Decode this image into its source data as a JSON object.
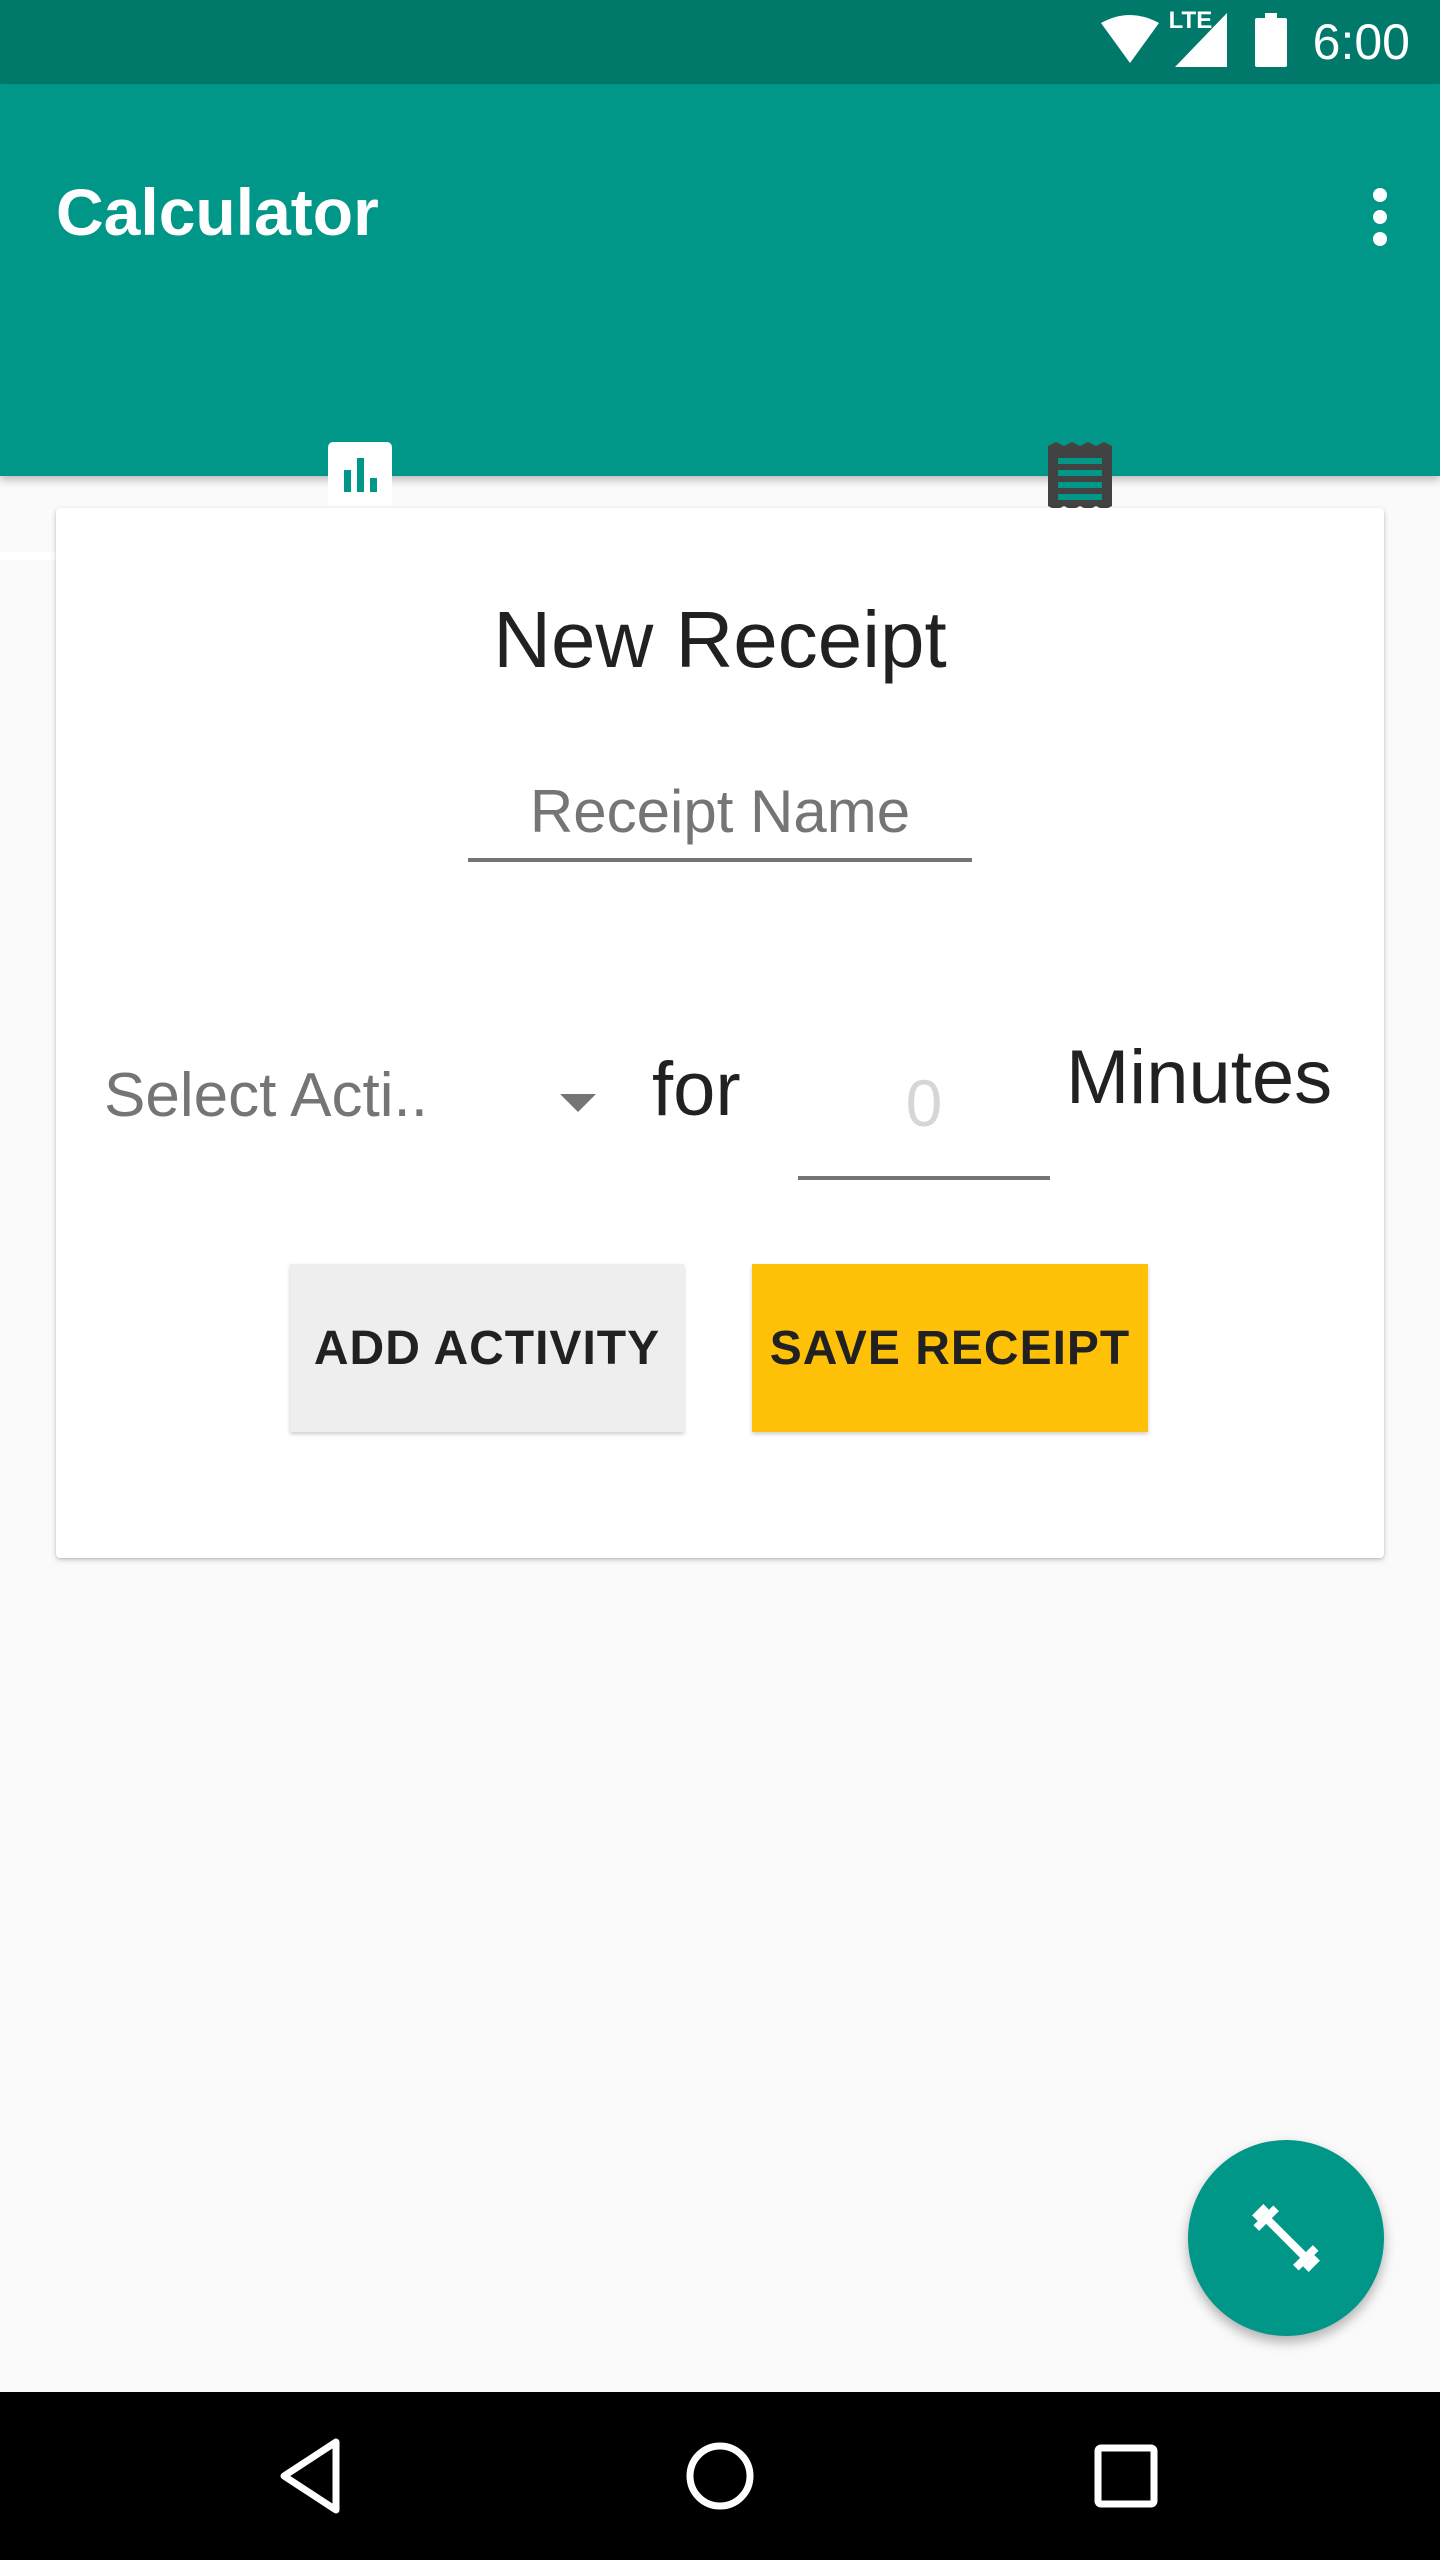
{
  "status_bar": {
    "time": "6:00",
    "network": "LTE",
    "icons": [
      "wifi-icon",
      "cell-signal-icon",
      "battery-icon"
    ]
  },
  "app_bar": {
    "title": "Calculator",
    "overflow_icon": "more-vert-icon"
  },
  "tabs": [
    {
      "icon": "bar-chart-icon",
      "selected": true
    },
    {
      "icon": "receipt-list-icon",
      "selected": false
    }
  ],
  "card": {
    "title": "New Receipt",
    "receipt_name_placeholder": "Receipt Name",
    "activity_select": "Select Acti..",
    "for_label": "for",
    "minutes_placeholder": "0",
    "minutes_label": "Minutes",
    "add_activity_label": "ADD ACTIVITY",
    "save_receipt_label": "SAVE RECEIPT"
  },
  "fab": {
    "icon": "fitness-dumbbell-icon"
  },
  "nav_bar": {
    "icons": [
      "back-icon",
      "home-icon",
      "recents-icon"
    ]
  },
  "colors": {
    "primary": "#009688",
    "primary_dark": "#00796B",
    "accent": "#FFC107",
    "background": "#FAFAFA"
  }
}
